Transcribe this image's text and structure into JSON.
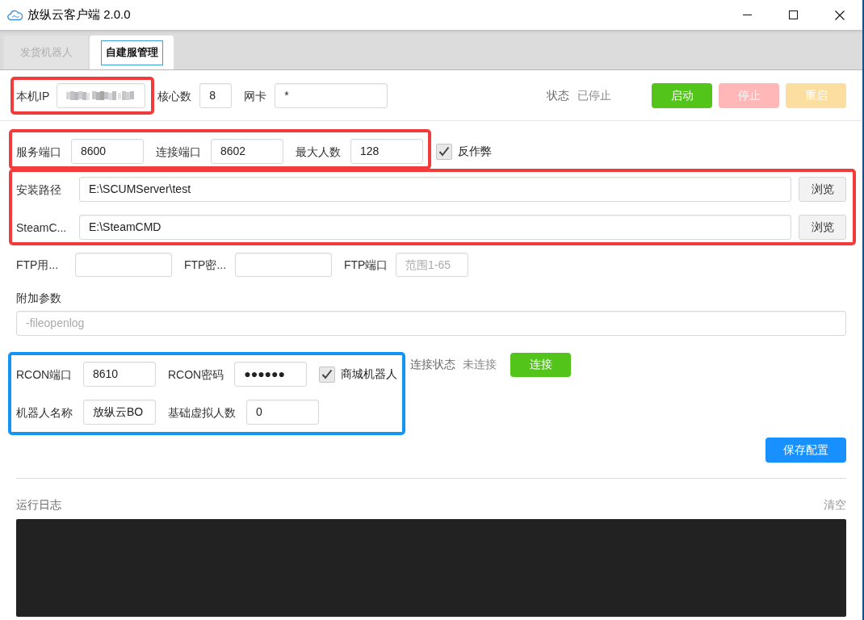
{
  "window": {
    "title": "放纵云客户端 2.0.0"
  },
  "tabs": [
    {
      "label": "发货机器人",
      "selected": false
    },
    {
      "label": "自建服管理",
      "selected": true
    }
  ],
  "server_bar": {
    "fields": [
      {
        "label": "本机IP",
        "kind": "redacted",
        "highlight": {
          "color": "#f23c3c"
        }
      },
      {
        "label": "核心数",
        "kind": "text",
        "value": "8"
      },
      {
        "label": "网卡",
        "kind": "text",
        "value": "*"
      }
    ],
    "status_label": "状态",
    "status_value": "已停止",
    "buttons": [
      {
        "label": "启动",
        "kind": "success",
        "disabled": false
      },
      {
        "label": "停止",
        "kind": "danger",
        "disabled": true
      },
      {
        "label": "重启",
        "kind": "warning",
        "disabled": true
      }
    ]
  },
  "ports": {
    "highlight": {
      "color": "#f23c3c"
    },
    "fields": [
      {
        "label": "服务端口",
        "value": "8600"
      },
      {
        "label": "连接端口",
        "value": "8602"
      },
      {
        "label": "最大人数",
        "value": "128"
      }
    ],
    "anticheat": {
      "label": "反作弊",
      "checked": true
    }
  },
  "paths": {
    "highlight": {
      "color": "#f23c3c"
    },
    "rows": [
      {
        "label": "安装路径",
        "value": "E:\\SCUMServer\\test",
        "button": "浏览"
      },
      {
        "label": "SteamC...",
        "value": "E:\\SteamCMD",
        "button": "浏览"
      }
    ]
  },
  "ftp": {
    "fields": [
      {
        "label": "FTP用..."
      },
      {
        "label": "FTP密..."
      },
      {
        "label": "FTP端口",
        "placeholder": "范围1-65"
      }
    ]
  },
  "extra_args": {
    "label": "附加参数",
    "placeholder": "-fileopenlog"
  },
  "rcon": {
    "highlight": {
      "color": "#1395f5"
    },
    "rows": [
      {
        "fields": [
          {
            "label": "RCON端口",
            "value": "8610"
          },
          {
            "label": "RCON密码",
            "value": "●●●●●●"
          }
        ],
        "checkbox": {
          "label": "商城机器人",
          "checked": true
        }
      },
      {
        "fields": [
          {
            "label": "机器人名称",
            "value": "放纵云BO"
          },
          {
            "label": "基础虚拟人数",
            "value": "0"
          }
        ]
      }
    ],
    "status_label": "连接状态",
    "status_value": "未连接",
    "connect_button": {
      "label": "连接",
      "kind": "success",
      "disabled": false
    }
  },
  "save_button": {
    "label": "保存配置",
    "kind": "primary",
    "disabled": false
  },
  "log": {
    "title": "运行日志",
    "clear_button": "清空"
  }
}
